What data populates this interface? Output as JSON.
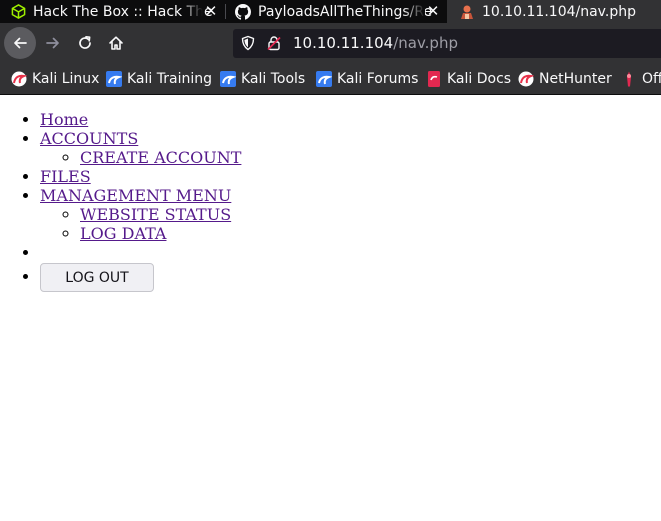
{
  "tabs": [
    {
      "title": "Hack The Box :: Hack The",
      "icon": "hackthebox-cube-icon",
      "active": false
    },
    {
      "title": "PayloadsAllTheThings/Re",
      "icon": "github-icon",
      "active": false
    },
    {
      "title": "10.10.11.104/nav.php",
      "icon": "page-favicon",
      "active": true
    }
  ],
  "urlbar": {
    "host": "10.10.11.104",
    "path": "/nav.php"
  },
  "bookmarks": [
    {
      "label": "Kali Linux",
      "icon": "kali-dragon-icon"
    },
    {
      "label": "Kali Training",
      "icon": "kali-training-icon"
    },
    {
      "label": "Kali Tools",
      "icon": "kali-tools-icon"
    },
    {
      "label": "Kali Forums",
      "icon": "kali-forums-icon"
    },
    {
      "label": "Kali Docs",
      "icon": "kali-docs-icon"
    },
    {
      "label": "NetHunter",
      "icon": "nethunter-icon"
    },
    {
      "label": "Off",
      "icon": "offsec-icon"
    }
  ],
  "nav": {
    "home": "Home",
    "accounts": "ACCOUNTS",
    "create_account": "CREATE ACCOUNT",
    "files": "FILES",
    "management_menu": "MANAGEMENT MENU",
    "website_status": "WEBSITE STATUS",
    "log_data": "LOG DATA",
    "logout": "LOG OUT"
  },
  "colors": {
    "chrome_dark": "#0c0c0d",
    "toolbar": "#323234",
    "link_visited": "#551a8b"
  }
}
